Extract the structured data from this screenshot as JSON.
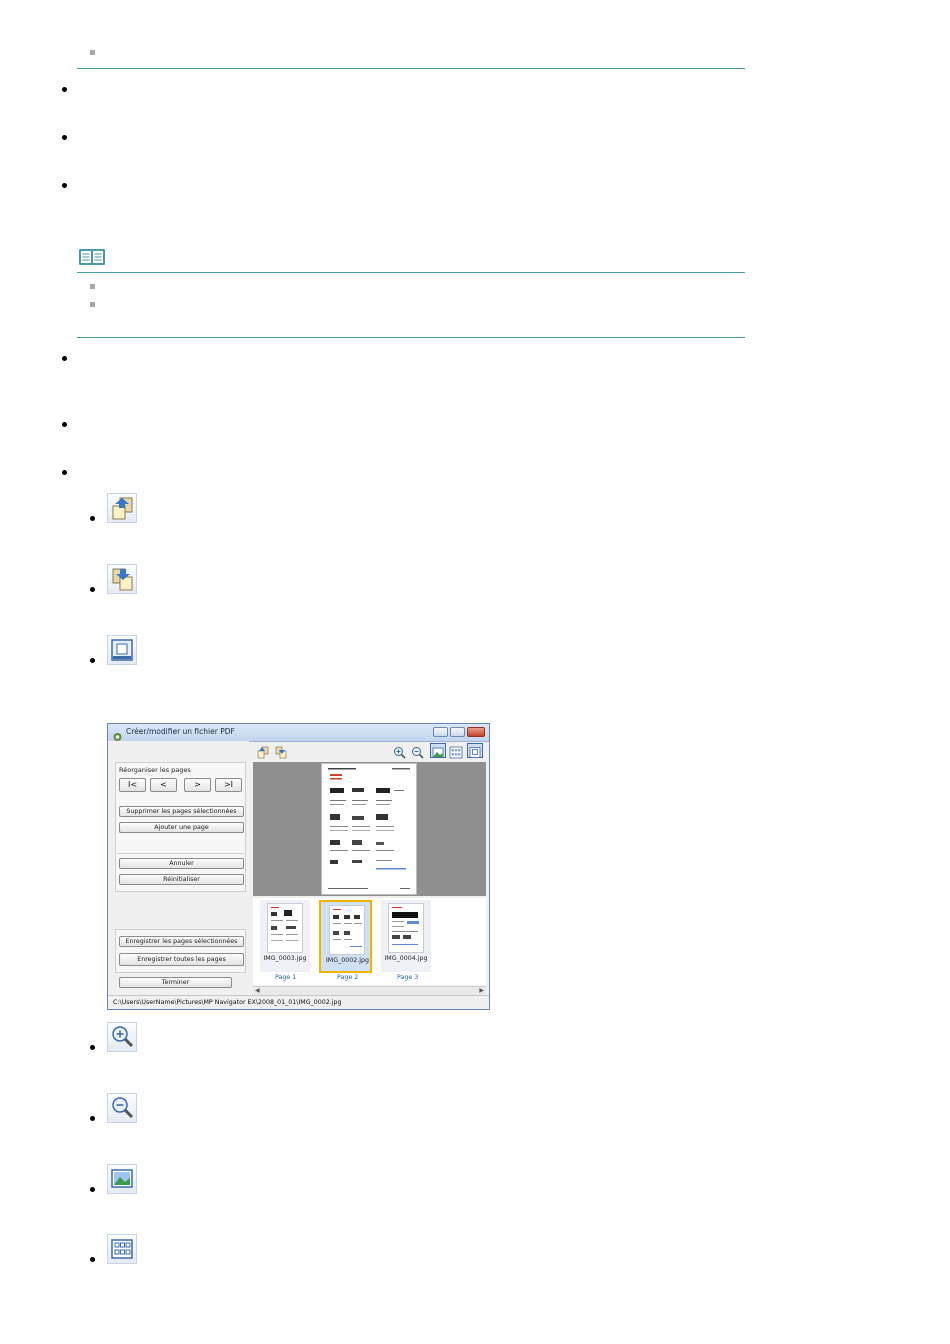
{
  "window": {
    "title": "Créer/modifier un fichier PDF",
    "rearrange_label": "Réorganiser les pages",
    "nav_first": "I<",
    "nav_prev": "<",
    "nav_next": ">",
    "nav_last": ">I",
    "delete_selected": "Supprimer les pages sélectionnées",
    "add_page": "Ajouter une page",
    "undo": "Annuler",
    "reset": "Réinitialiser",
    "save_selected": "Enregistrer les pages sélectionnées",
    "save_all": "Enregistrer toutes les pages",
    "finish": "Terminer",
    "thumbnails": [
      {
        "file": "IMG_0003.jpg",
        "page": "Page 1"
      },
      {
        "file": "IMG_0002.jpg",
        "page": "Page 2"
      },
      {
        "file": "IMG_0004.jpg",
        "page": "Page 3"
      }
    ],
    "status_path": "C:\\Users\\UserName\\Pictures\\MP Navigator EX\\2008_01_01\\IMG_0002.jpg"
  },
  "colors": {
    "rule": "#4a9aa8",
    "selection": "#f0b400",
    "link": "#2a5db0"
  },
  "icons": {
    "move_up": "page-move-up-icon",
    "move_down": "page-move-down-icon",
    "full_screen": "full-screen-icon",
    "zoom_in": "zoom-in-icon",
    "zoom_out": "zoom-out-icon",
    "preview": "preview-image-icon",
    "thumbnails": "thumbnail-grid-icon"
  }
}
